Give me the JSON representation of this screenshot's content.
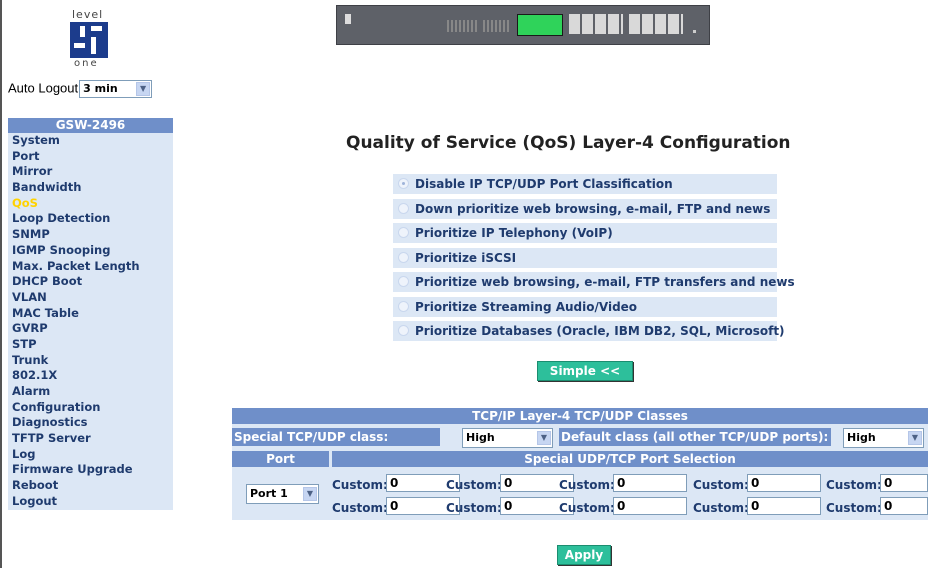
{
  "brand": {
    "top": "level",
    "bottom": "one"
  },
  "autologout": {
    "label": "Auto Logout",
    "value": "3 min"
  },
  "menu": {
    "header": "GSW-2496",
    "active": "QoS",
    "items": [
      "System",
      "Port",
      "Mirror",
      "Bandwidth",
      "QoS",
      "Loop Detection",
      "SNMP",
      "IGMP Snooping",
      "Max. Packet Length",
      "DHCP Boot",
      "VLAN",
      "MAC Table",
      "GVRP",
      "STP",
      "Trunk",
      "802.1X",
      "Alarm",
      "Configuration",
      "Diagnostics",
      "TFTP Server",
      "Log",
      "Firmware Upgrade",
      "Reboot",
      "Logout"
    ]
  },
  "page": {
    "title": "Quality of Service (QoS) Layer-4 Configuration"
  },
  "qos_options": [
    {
      "label": "Disable IP TCP/UDP Port Classification",
      "selected": true
    },
    {
      "label": "Down prioritize web browsing, e-mail, FTP and news",
      "selected": false
    },
    {
      "label": "Prioritize IP Telephony (VoIP)",
      "selected": false
    },
    {
      "label": "Prioritize iSCSI",
      "selected": false
    },
    {
      "label": "Prioritize web browsing, e-mail, FTP transfers and news",
      "selected": false
    },
    {
      "label": "Prioritize Streaming Audio/Video",
      "selected": false
    },
    {
      "label": "Prioritize Databases (Oracle, IBM DB2, SQL, Microsoft)",
      "selected": false
    }
  ],
  "buttons": {
    "simple": "Simple <<",
    "apply": "Apply"
  },
  "table": {
    "title": "TCP/IP Layer-4 TCP/UDP Classes",
    "special_label": "Special TCP/UDP class:",
    "special_value": "High",
    "default_label": "Default class (all other TCP/UDP ports):",
    "default_value": "High",
    "port_header": "Port",
    "selection_header": "Special UDP/TCP Port Selection",
    "port_value": "Port 1",
    "custom_label": "Custom:",
    "custom_values": [
      [
        "0",
        "0",
        "0",
        "0",
        "0"
      ],
      [
        "0",
        "0",
        "0",
        "0",
        "0"
      ]
    ]
  },
  "colors": {
    "accent": "#6f8fc9",
    "row_bg": "#dce7f5",
    "text": "#1f3b6e",
    "button": "#2dbf9b",
    "active_menu": "#ffd200"
  }
}
